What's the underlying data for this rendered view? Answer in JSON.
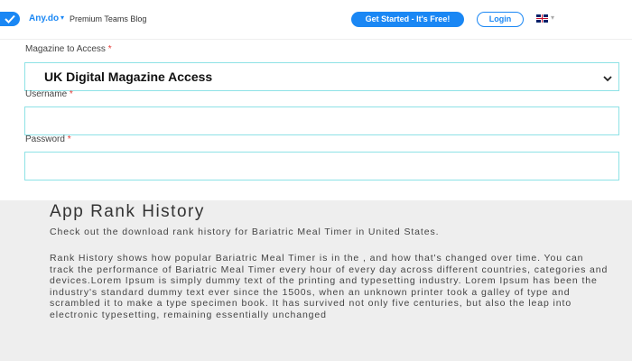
{
  "header": {
    "brand": "Any.do",
    "nav_item": "Premium Teams Blog",
    "get_started_label": "Get Started - It's Free!",
    "login_label": "Login",
    "language_flag": "uk-flag-icon"
  },
  "form": {
    "magazine_label": "Magazine to Access",
    "magazine_value": "UK Digital Magazine Access",
    "username_label": "Username",
    "password_label": "Password",
    "required_marker": "*"
  },
  "rank": {
    "title": "App Rank History",
    "intro": "Check out the download rank history for Bariatric Meal Timer in United States.",
    "body": "Rank History shows how popular Bariatric Meal Timer is in the , and how that's changed over time. You can track the performance of Bariatric Meal Timer every hour of every day across different countries, categories and devices.Lorem Ipsum is simply dummy text of the printing and typesetting industry. Lorem Ipsum has been the industry's standard dummy text ever since the 1500s, when an unknown printer took a galley of type and scrambled it to make a type specimen book. It has survived not only five centuries, but also the leap into electronic typesetting, remaining essentially unchanged"
  },
  "colors": {
    "accent": "#1a87f4",
    "field_border": "#8ee2e6",
    "section_bg": "#eeeeee"
  }
}
